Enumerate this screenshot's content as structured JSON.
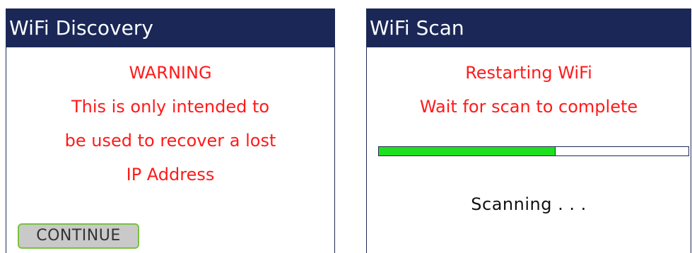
{
  "discovery": {
    "title": "WiFi Discovery",
    "warning_lines": [
      "WARNING",
      "This is only intended to",
      "be used to recover a lost",
      "IP Address"
    ],
    "continue_label": "CONTINUE"
  },
  "scan": {
    "title": "WiFi Scan",
    "message_lines": [
      "Restarting WiFi",
      "Wait for scan to complete"
    ],
    "progress": 0.57,
    "status": "Scanning . . ."
  },
  "colors": {
    "header_bg": "#1a2757",
    "warning_text": "#ff1a1a",
    "progress_fill": "#1ee01e",
    "button_border": "#7ac142",
    "button_bg": "#c9c9c9"
  }
}
